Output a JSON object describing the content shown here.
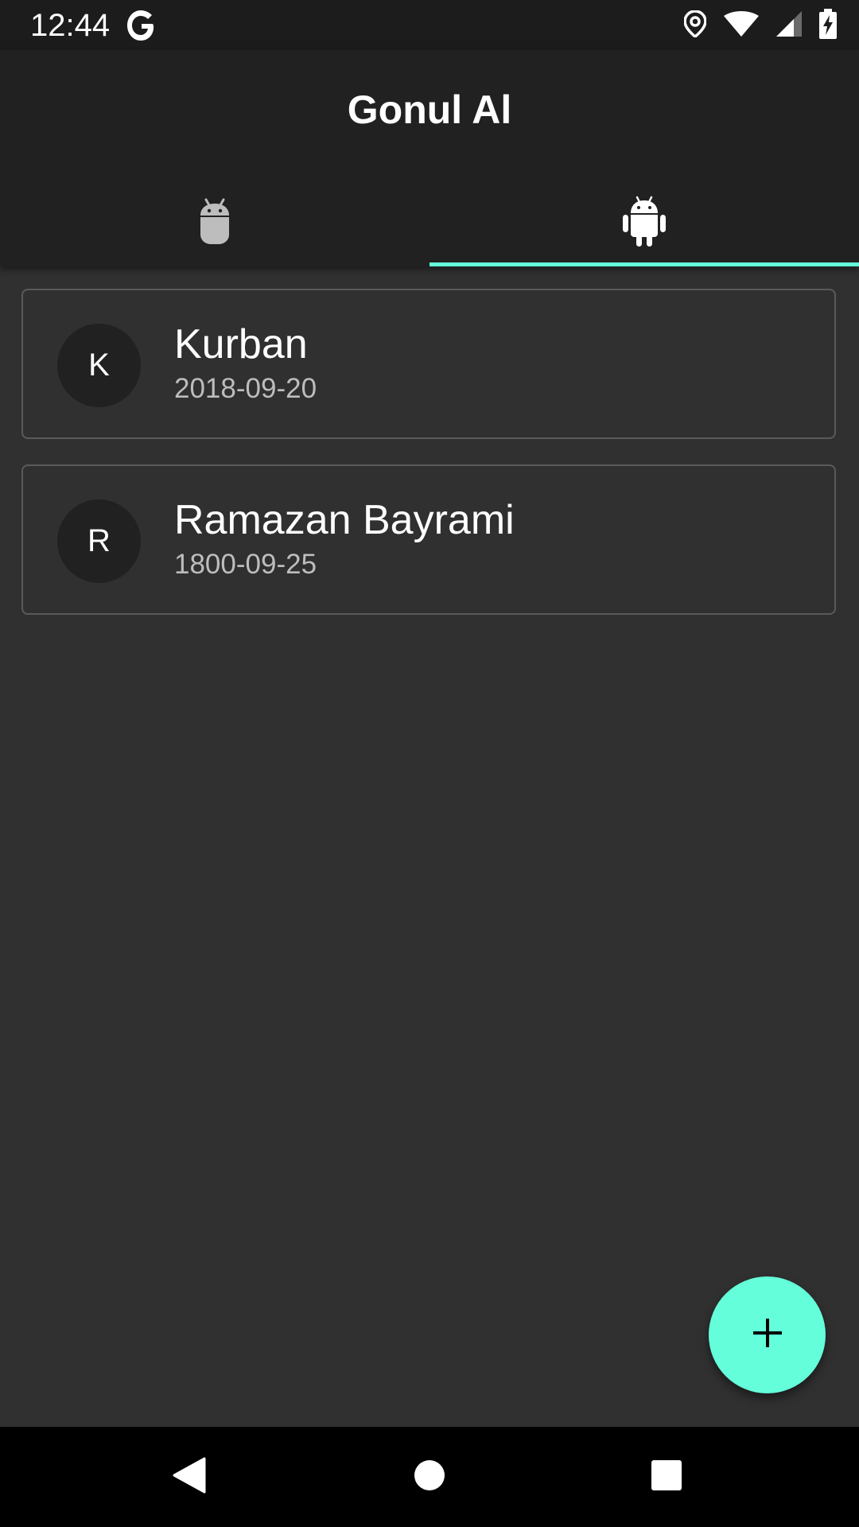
{
  "status_bar": {
    "time": "12:44",
    "icons": [
      "google-icon",
      "location-icon",
      "wifi-icon",
      "signal-icon",
      "battery-charging-icon"
    ]
  },
  "app_bar": {
    "title": "Gonul Al"
  },
  "tabs": [
    {
      "icon": "android-outline-icon",
      "selected": false
    },
    {
      "icon": "android-icon",
      "selected": true
    }
  ],
  "items": [
    {
      "avatar": "K",
      "title": "Kurban",
      "date": "2018-09-20"
    },
    {
      "avatar": "R",
      "title": "Ramazan Bayrami",
      "date": "1800-09-25"
    }
  ],
  "fab": {
    "icon": "plus-icon"
  },
  "nav_bar": {
    "icons": [
      "back-icon",
      "home-icon",
      "recents-icon"
    ]
  },
  "colors": {
    "accent": "#64ffda",
    "background": "#303030",
    "app_bar": "#212121",
    "status_bar": "#1c1c1c",
    "nav_bar": "#000000"
  }
}
